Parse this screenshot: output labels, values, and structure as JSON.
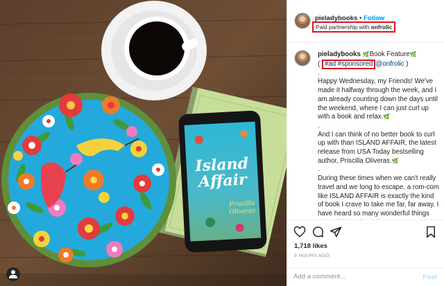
{
  "post": {
    "username": "pieladybooks",
    "separator": "•",
    "follow_label": "Follow",
    "partnership_prefix": "Paid partnership with",
    "partner_name": "onfrolic"
  },
  "caption": {
    "username": "pieladybooks",
    "title_text": "Book Feature",
    "leaf_glyph": "🌿",
    "open_paren": "(",
    "tags": "#ad #sponsored",
    "mention": "@onfrolic",
    "close_paren": ")",
    "dot": ".",
    "paragraph_1": "Happy Wednesday, my Friends! We've made it halfway through the week, and I am already counting down the days until the weekend, where I can just curl up with a book and relax.",
    "paragraph_2": "And I can think of no better book to curl up with than ISLAND AFFAIR, the latest release from USA Today bestselling author, Priscilla Oliveras.",
    "paragraph_3": "During these times when we can't really travel and we long to escape, a rom-com like ISLAND AFFAIR is exactly the kind of book I crave to take me far, far away. I have heard so many wonderful things about this book, and"
  },
  "book_cover": {
    "title_line1": "Island",
    "title_line2": "Affair",
    "author_line1": "Priscilla",
    "author_line2": "Oliveras"
  },
  "actions": {
    "likes": "1,718 likes",
    "time_ago": "9 HOURS AGO",
    "comment_placeholder": "Add a comment...",
    "post_label": "Post"
  },
  "icons": [
    "heart-icon",
    "comment-icon",
    "share-icon",
    "bookmark-icon",
    "user-tag-icon"
  ],
  "colors": {
    "link_blue": "#0095f6",
    "highlight_red": "#e2101b",
    "post_disabled": "#b2dffc",
    "text": "#262626",
    "muted": "#8e8e8e"
  }
}
